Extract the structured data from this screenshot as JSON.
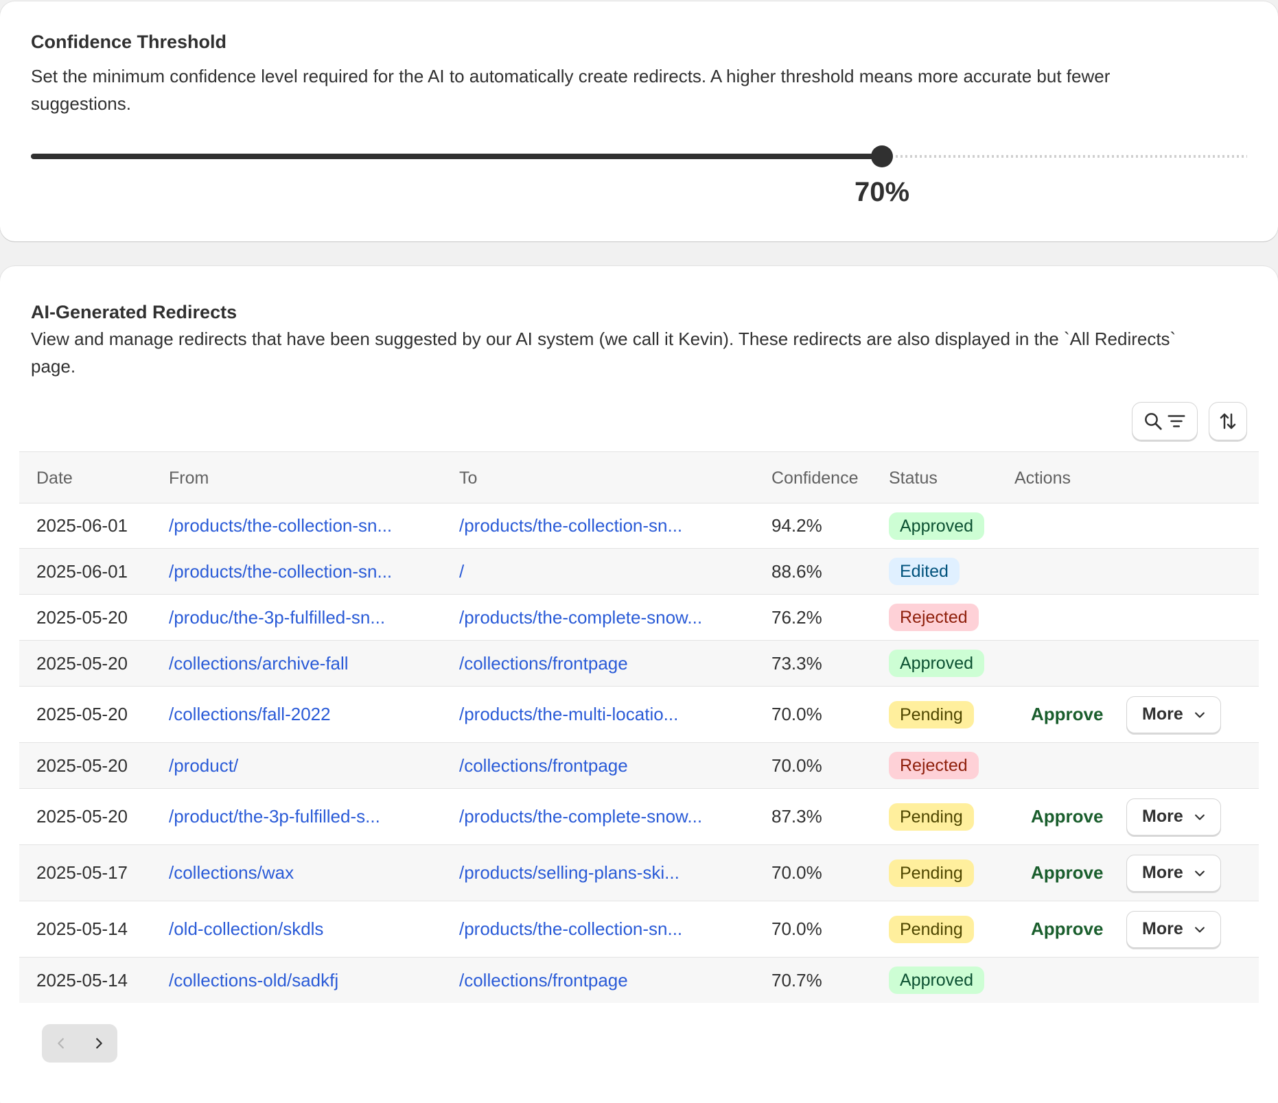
{
  "threshold": {
    "title": "Confidence Threshold",
    "description": "Set the minimum confidence level required for the AI to automatically create redirects. A higher threshold means more accurate but fewer suggestions.",
    "value": 0.7,
    "value_label": "70%"
  },
  "redirects": {
    "title": "AI-Generated Redirects",
    "description": "View and manage redirects that have been suggested by our AI system (we call it Kevin). These redirects are also displayed in the `All Redirects` page.",
    "toolbar": {
      "search_filter_icons": [
        "search-icon",
        "filter-icon"
      ],
      "sort_icon": "sort-icon"
    },
    "columns": {
      "date": "Date",
      "from": "From",
      "to": "To",
      "confidence": "Confidence",
      "status": "Status",
      "actions": "Actions"
    },
    "approve_label": "Approve",
    "more_label": "More",
    "rows": [
      {
        "date": "2025-06-01",
        "from": "/products/the-collection-sn...",
        "to": "/products/the-collection-sn...",
        "confidence": "94.2%",
        "status": "Approved"
      },
      {
        "date": "2025-06-01",
        "from": "/products/the-collection-sn...",
        "to": "/",
        "confidence": "88.6%",
        "status": "Edited"
      },
      {
        "date": "2025-05-20",
        "from": "/produc/the-3p-fulfilled-sn...",
        "to": "/products/the-complete-snow...",
        "confidence": "76.2%",
        "status": "Rejected"
      },
      {
        "date": "2025-05-20",
        "from": "/collections/archive-fall",
        "to": "/collections/frontpage",
        "confidence": "73.3%",
        "status": "Approved"
      },
      {
        "date": "2025-05-20",
        "from": "/collections/fall-2022",
        "to": "/products/the-multi-locatio...",
        "confidence": "70.0%",
        "status": "Pending"
      },
      {
        "date": "2025-05-20",
        "from": "/product/",
        "to": "/collections/frontpage",
        "confidence": "70.0%",
        "status": "Rejected"
      },
      {
        "date": "2025-05-20",
        "from": "/product/the-3p-fulfilled-s...",
        "to": "/products/the-complete-snow...",
        "confidence": "87.3%",
        "status": "Pending"
      },
      {
        "date": "2025-05-17",
        "from": "/collections/wax",
        "to": "/products/selling-plans-ski...",
        "confidence": "70.0%",
        "status": "Pending"
      },
      {
        "date": "2025-05-14",
        "from": "/old-collection/skdls",
        "to": "/products/the-collection-sn...",
        "confidence": "70.0%",
        "status": "Pending"
      },
      {
        "date": "2025-05-14",
        "from": "/collections-old/sadkfj",
        "to": "/collections/frontpage",
        "confidence": "70.7%",
        "status": "Approved"
      }
    ],
    "status_colors": {
      "Approved": {
        "bg": "#cdfed4",
        "fg": "#0c5132"
      },
      "Edited": {
        "bg": "#e0f0ff",
        "fg": "#00527c"
      },
      "Rejected": {
        "bg": "#fed1d7",
        "fg": "#8e1f0b"
      },
      "Pending": {
        "bg": "#ffef9d",
        "fg": "#4f4700"
      }
    },
    "pagination": {
      "prev_icon": "chevron-left-icon",
      "next_icon": "chevron-right-icon",
      "prev_enabled": false,
      "next_enabled": true
    }
  }
}
